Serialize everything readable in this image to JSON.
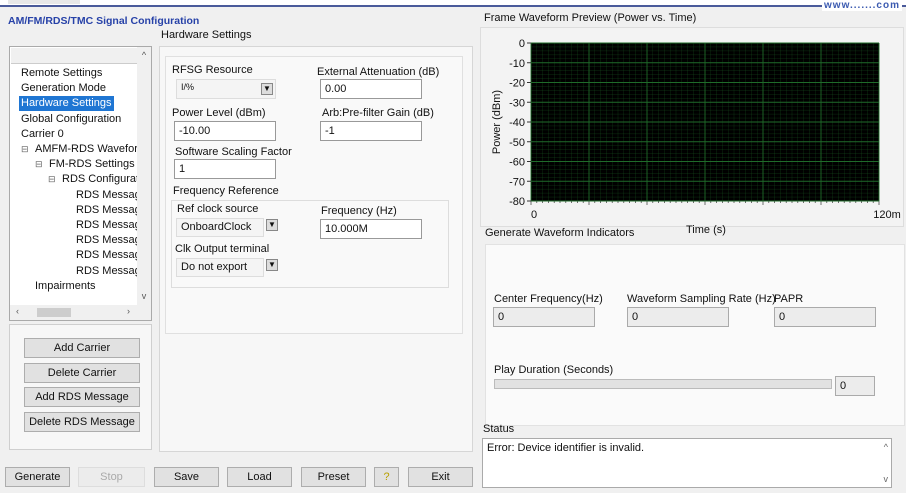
{
  "app": {
    "title": "AM/FM/RDS/TMC Signal Configuration",
    "watermark": "www.......com"
  },
  "tree": {
    "items": [
      {
        "label": "Remote Settings",
        "indent": 0
      },
      {
        "label": "Generation Mode",
        "indent": 0
      },
      {
        "label": "Hardware Settings",
        "indent": 0,
        "selected": true
      },
      {
        "label": "Global Configuration",
        "indent": 0
      },
      {
        "label": "Carrier 0",
        "indent": 0
      },
      {
        "label": "AMFM-RDS Wavefor",
        "indent": 1,
        "expander": "⊟"
      },
      {
        "label": "FM-RDS Settings",
        "indent": 2,
        "expander": "⊟"
      },
      {
        "label": "RDS Configurat",
        "indent": 3,
        "expander": "⊟"
      },
      {
        "label": "RDS Messag",
        "indent": 4
      },
      {
        "label": "RDS Messag",
        "indent": 4
      },
      {
        "label": "RDS Messag",
        "indent": 4
      },
      {
        "label": "RDS Messag",
        "indent": 4
      },
      {
        "label": "RDS Messag",
        "indent": 4
      },
      {
        "label": "RDS Messag",
        "indent": 4
      },
      {
        "label": "Impairments",
        "indent": 1
      }
    ]
  },
  "side_buttons": [
    "Add Carrier",
    "Delete Carrier",
    "Add RDS Message",
    "Delete RDS Message"
  ],
  "hardware": {
    "section_title": "Hardware Settings",
    "rfsg_label": "RFSG Resource",
    "rfsg_value": "I/%",
    "ext_att_label": "External Attenuation (dB)",
    "ext_att_value": "0.00",
    "power_label": "Power Level (dBm)",
    "power_value": "-10.00",
    "arb_label": "Arb:Pre-filter Gain (dB)",
    "arb_value": "-1",
    "scaling_label": "Software Scaling Factor",
    "scaling_value": "1",
    "freq_ref_title": "Frequency Reference",
    "ref_clock_label": "Ref clock source",
    "ref_clock_value": "OnboardClock",
    "freq_label": "Frequency (Hz)",
    "freq_value": "10.000M",
    "clk_out_label": "Clk Output terminal",
    "clk_out_value": "Do not export"
  },
  "preview": {
    "title": "Frame Waveform Preview (Power vs. Time)"
  },
  "chart_data": {
    "type": "line",
    "title": "",
    "xlabel": "Time (s)",
    "ylabel": "Power (dBm)",
    "xlim": [
      0,
      0.12
    ],
    "ylim": [
      -80,
      0
    ],
    "yticks": [
      "0",
      "-10",
      "-20",
      "-30",
      "-40",
      "-50",
      "-60",
      "-70",
      "-80"
    ],
    "xticks": [
      "0",
      "120m"
    ],
    "grid": true,
    "background": "#000000",
    "grid_color": "#1f6b2a",
    "series": []
  },
  "indicators": {
    "title": "Generate Waveform Indicators",
    "center_freq_label": "Center Frequency(Hz)",
    "center_freq_value": "0",
    "sampling_label": "Waveform Sampling Rate (Hz)",
    "sampling_value": "0",
    "papr_label": "PAPR",
    "papr_value": "0",
    "play_label": "Play Duration (Seconds)",
    "play_value": "0",
    "play_progress": 0
  },
  "status": {
    "label": "Status",
    "text": "Error:  Device identifier is invalid."
  },
  "bottom_buttons": {
    "generate": "Generate",
    "stop": "Stop",
    "save": "Save",
    "load": "Load",
    "preset": "Preset",
    "help": "?",
    "exit": "Exit"
  }
}
